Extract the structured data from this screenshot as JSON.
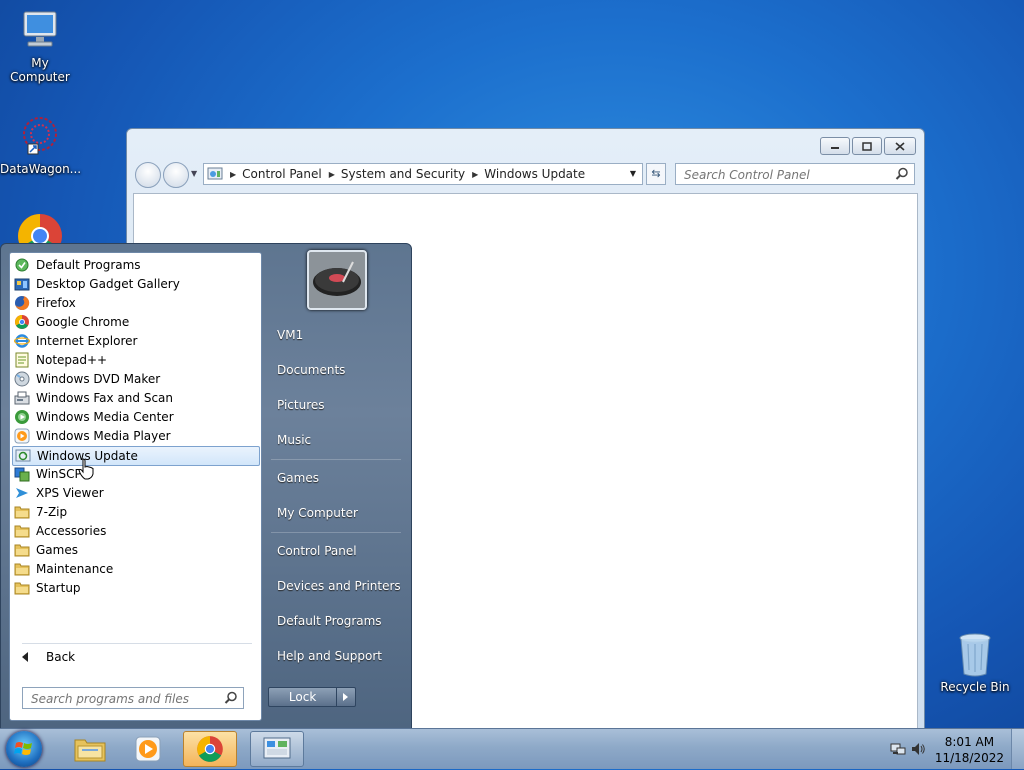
{
  "desktop": {
    "icons": [
      {
        "label": "My Computer"
      },
      {
        "label": "DataWagon..."
      },
      {
        "label": "Recycle Bin"
      }
    ]
  },
  "window": {
    "breadcrumbs": [
      "Control Panel",
      "System and Security",
      "Windows Update"
    ],
    "search_placeholder": "Search Control Panel"
  },
  "start_menu": {
    "programs": [
      {
        "label": "Default Programs",
        "icon": "default-programs-icon"
      },
      {
        "label": "Desktop Gadget Gallery",
        "icon": "gadget-gallery-icon"
      },
      {
        "label": "Firefox",
        "icon": "firefox-icon"
      },
      {
        "label": "Google Chrome",
        "icon": "chrome-icon"
      },
      {
        "label": "Internet Explorer",
        "icon": "internet-explorer-icon"
      },
      {
        "label": "Notepad++",
        "icon": "notepad-plus-plus-icon"
      },
      {
        "label": "Windows DVD Maker",
        "icon": "dvd-maker-icon"
      },
      {
        "label": "Windows Fax and Scan",
        "icon": "fax-scan-icon"
      },
      {
        "label": "Windows Media Center",
        "icon": "media-center-icon"
      },
      {
        "label": "Windows Media Player",
        "icon": "media-player-icon"
      },
      {
        "label": "Windows Update",
        "icon": "windows-update-icon",
        "selected": true
      },
      {
        "label": "WinSCP",
        "icon": "winscp-icon"
      },
      {
        "label": "XPS Viewer",
        "icon": "xps-viewer-icon"
      },
      {
        "label": "7-Zip",
        "icon": "folder-icon"
      },
      {
        "label": "Accessories",
        "icon": "folder-icon"
      },
      {
        "label": "Games",
        "icon": "folder-icon"
      },
      {
        "label": "Maintenance",
        "icon": "folder-icon"
      },
      {
        "label": "Startup",
        "icon": "folder-icon"
      }
    ],
    "back_label": "Back",
    "search_placeholder": "Search programs and files",
    "right_links": [
      {
        "label": "VM1"
      },
      {
        "label": "Documents"
      },
      {
        "label": "Pictures"
      },
      {
        "label": "Music"
      },
      {
        "label": "Games"
      },
      {
        "label": "My Computer"
      },
      {
        "label": "Control Panel"
      },
      {
        "label": "Devices and Printers"
      },
      {
        "label": "Default Programs"
      },
      {
        "label": "Help and Support"
      }
    ],
    "lock_label": "Lock"
  },
  "taskbar": {
    "time": "8:01 AM",
    "date": "11/18/2022"
  }
}
